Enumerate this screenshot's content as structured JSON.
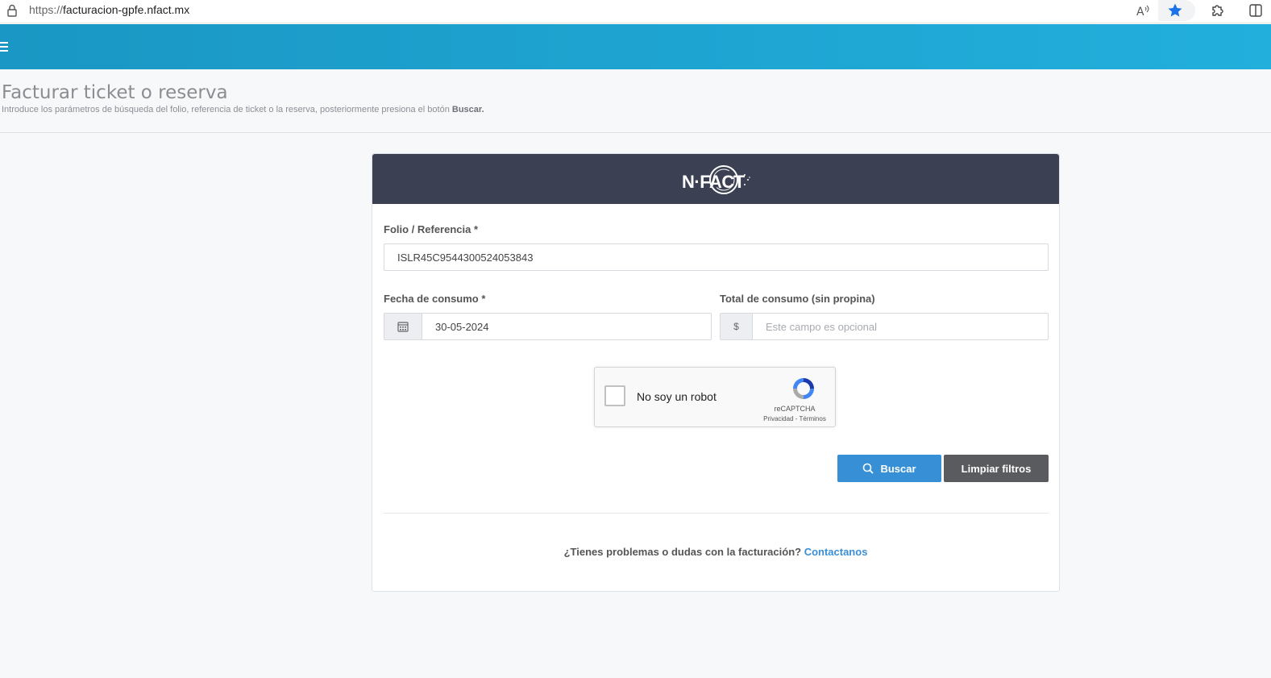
{
  "browser": {
    "url_protocol": "https://",
    "url_host": "facturacion-gpfe.nfact.mx"
  },
  "page": {
    "title": "Facturar ticket o reserva",
    "subtitle_prefix": "Introduce los parámetros de búsqueda del folio, referencia de ticket o la reserva, posteriormente presiona el botón ",
    "subtitle_bold": "Buscar."
  },
  "form": {
    "folio_label": "Folio / Referencia *",
    "folio_value": "ISLR45C9544300524053843",
    "fecha_label": "Fecha de consumo *",
    "fecha_value": "30-05-2024",
    "total_label": "Total de consumo (sin propina)",
    "total_addon": "$",
    "total_placeholder": "Este campo es opcional"
  },
  "captcha": {
    "label": "No soy un robot",
    "brand": "reCAPTCHA",
    "links": "Privacidad - Términos"
  },
  "buttons": {
    "search": "Buscar",
    "clear": "Limpiar filtros"
  },
  "help": {
    "question": "¿Tienes problemas o dudas con la facturación? ",
    "link": "Contactanos"
  },
  "colors": {
    "header_start": "#1a97c4",
    "header_end": "#22afdc",
    "card_header": "#3b4152",
    "primary": "#3790d6",
    "dark_button": "#5a5b5e",
    "link": "#3b8fd4"
  }
}
